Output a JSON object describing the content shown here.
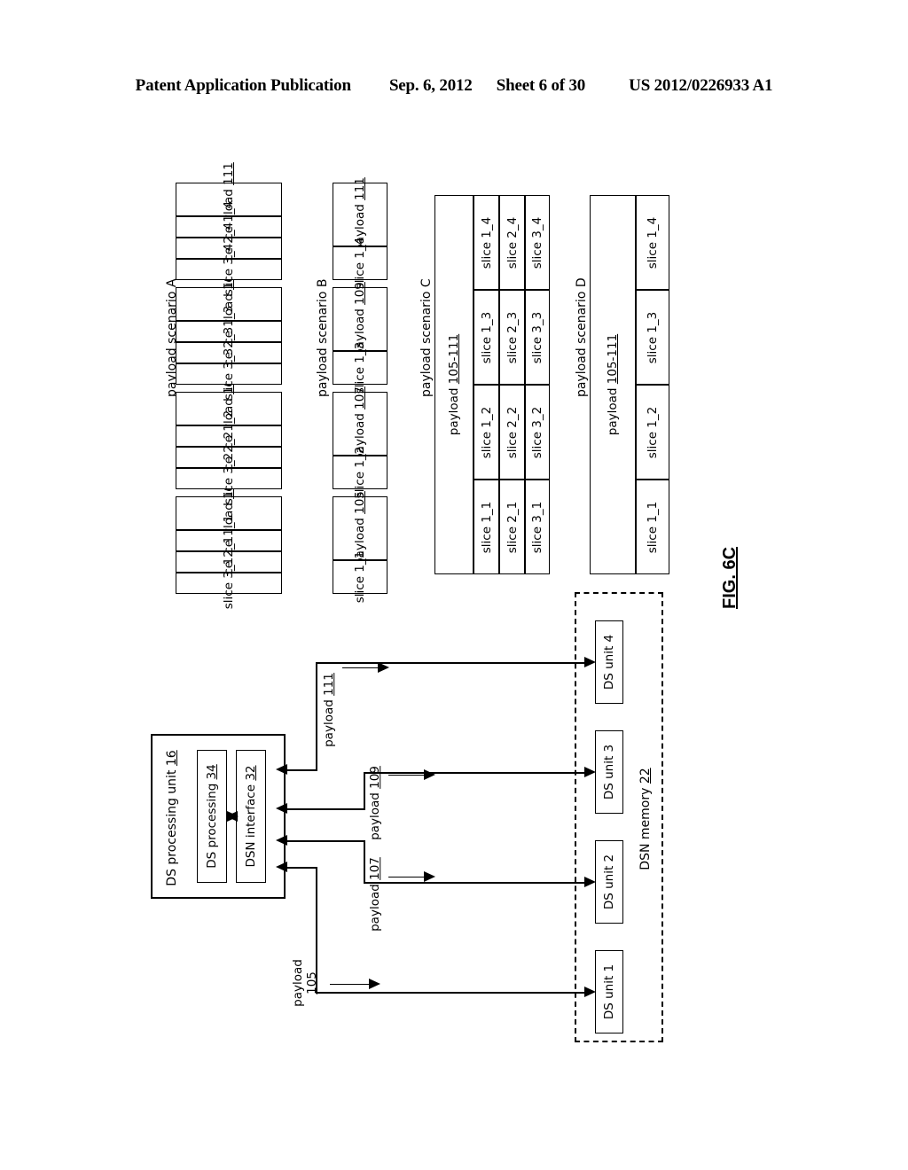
{
  "header": {
    "publication": "Patent Application Publication",
    "date": "Sep. 6, 2012",
    "sheet": "Sheet 6 of 30",
    "patent_number": "US 2012/0226933 A1"
  },
  "figure": {
    "label": "FIG. 6C"
  },
  "scenarios": [
    {
      "id": "a",
      "title": "payload scenario A",
      "payloads": [
        {
          "label": "payload 105",
          "name": "payload",
          "ref": "105",
          "slices": [
            "slice 1_1",
            "slice 2_1",
            "slice 3_1"
          ]
        },
        {
          "label": "payload 107",
          "name": "payload",
          "ref": "107",
          "slices": [
            "slice 1_2",
            "slice 2_2",
            "slice 3_2"
          ]
        },
        {
          "label": "payload 109",
          "name": "payload",
          "ref": "109",
          "slices": [
            "slice 1_3",
            "slice 2_3",
            "slice 3_3"
          ]
        },
        {
          "label": "payload 111",
          "name": "payload",
          "ref": "111",
          "slices": [
            "slice 1_4",
            "slice 2_4",
            "slice 3_4"
          ]
        }
      ]
    },
    {
      "id": "b",
      "title": "payload scenario B",
      "payloads": [
        {
          "label": "payload 105",
          "name": "payload",
          "ref": "105",
          "slices": [
            "slice 1_1"
          ]
        },
        {
          "label": "payload 107",
          "name": "payload",
          "ref": "107",
          "slices": [
            "slice 1_2"
          ]
        },
        {
          "label": "payload 109",
          "name": "payload",
          "ref": "109",
          "slices": [
            "slice 1_3"
          ]
        },
        {
          "label": "payload 111",
          "name": "payload",
          "ref": "111",
          "slices": [
            "slice 1_4"
          ]
        }
      ]
    },
    {
      "id": "c",
      "title": "payload scenario C",
      "payload_label": "payload 105-111",
      "payload_name": "payload",
      "payload_ref": "105-111",
      "grid": [
        [
          "slice 1_1",
          "slice 1_2",
          "slice 1_3",
          "slice 1_4"
        ],
        [
          "slice 2_1",
          "slice 2_2",
          "slice 2_3",
          "slice 2_4"
        ],
        [
          "slice 3_1",
          "slice 3_2",
          "slice 3_3",
          "slice 3_4"
        ]
      ]
    },
    {
      "id": "d",
      "title": "payload scenario D",
      "payload_label": "payload 105-111",
      "payload_name": "payload",
      "payload_ref": "105-111",
      "grid": [
        [
          "slice 1_1",
          "slice 1_2",
          "slice 1_3",
          "slice 1_4"
        ]
      ]
    }
  ],
  "system": {
    "ds_processing_unit": {
      "name": "DS processing unit",
      "ref": "16",
      "label": "DS processing unit 16"
    },
    "ds_processing": {
      "name": "DS processing",
      "ref": "34",
      "label": "DS processing 34"
    },
    "dsn_interface": {
      "name": "DSN interface",
      "ref": "32",
      "label": "DSN interface 32"
    },
    "dsn_memory": {
      "name": "DSN memory",
      "ref": "22",
      "label": "DSN memory 22"
    },
    "ds_units": [
      {
        "label": "DS unit 1"
      },
      {
        "label": "DS unit 2"
      },
      {
        "label": "DS unit 3"
      },
      {
        "label": "DS unit 4"
      }
    ],
    "flows": [
      {
        "name": "payload",
        "ref": "105",
        "line1": "payload",
        "line2": "105",
        "label": "payload 105"
      },
      {
        "name": "payload",
        "ref": "107",
        "line1": "payload",
        "line2": "107",
        "label": "payload 107"
      },
      {
        "name": "payload",
        "ref": "109",
        "line1": "payload",
        "line2": "109",
        "label": "payload 109"
      },
      {
        "name": "payload",
        "ref": "111",
        "line1": "payload",
        "line2": "111",
        "label": "payload 111"
      }
    ]
  }
}
